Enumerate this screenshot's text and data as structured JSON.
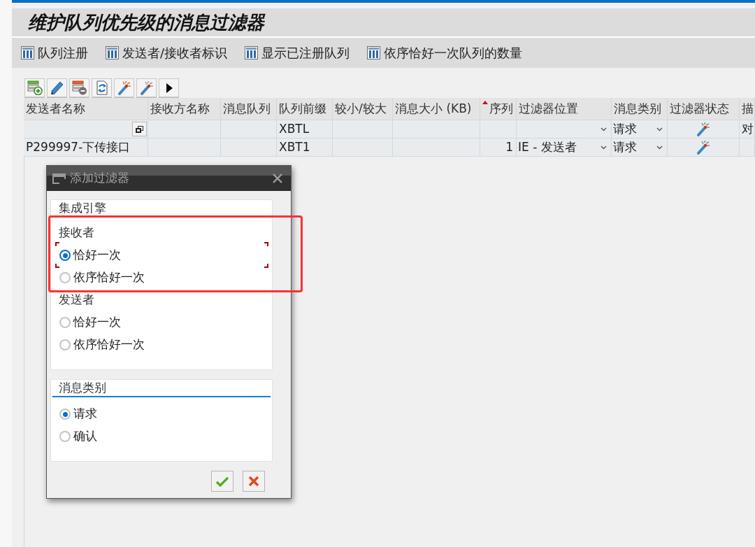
{
  "page": {
    "title": "维护队列优先级的消息过滤器"
  },
  "menu": [
    "队列注册",
    "发送者/接收者标识",
    "显示已注册队列",
    "依序恰好一次队列的数量"
  ],
  "table": {
    "columns": [
      {
        "label": "发送者名称",
        "sorted": false
      },
      {
        "label": "接收方名称",
        "sorted": false
      },
      {
        "label": "消息队列",
        "sorted": false
      },
      {
        "label": "队列前缀",
        "sorted": false
      },
      {
        "label": "较小/较大",
        "sorted": false
      },
      {
        "label": "消息大小 (KB)",
        "sorted": false
      },
      {
        "label": "序列",
        "sorted": true
      },
      {
        "label": "过滤器位置",
        "sorted": false
      },
      {
        "label": "消息类别",
        "sorted": false
      },
      {
        "label": "过滤器状态",
        "sorted": false
      },
      {
        "label": "描",
        "sorted": false
      }
    ],
    "rows": [
      {
        "cells": [
          {
            "kind": "help"
          },
          {
            "kind": "text"
          },
          {
            "kind": "text"
          },
          {
            "kind": "text",
            "text": "XBTL"
          },
          {
            "kind": "text"
          },
          {
            "kind": "text"
          },
          {
            "kind": "number"
          },
          {
            "kind": "dropdown"
          },
          {
            "kind": "dropdown",
            "text": "请求"
          },
          {
            "kind": "status"
          },
          {
            "kind": "text",
            "text": "对"
          }
        ]
      },
      {
        "cells": [
          {
            "kind": "text",
            "text": "P299997-下传接口"
          },
          {
            "kind": "text"
          },
          {
            "kind": "text"
          },
          {
            "kind": "text",
            "text": "XBT1"
          },
          {
            "kind": "text"
          },
          {
            "kind": "text"
          },
          {
            "kind": "number",
            "text": "1"
          },
          {
            "kind": "dropdown",
            "text": "IE - 发送者"
          },
          {
            "kind": "dropdown",
            "text": "请求"
          },
          {
            "kind": "status"
          },
          {
            "kind": "text"
          }
        ]
      }
    ]
  },
  "dialog": {
    "title": "添加过滤器",
    "groups": [
      {
        "title": "集成引擎",
        "underline": false,
        "sections": [
          {
            "label": "接收者",
            "options": [
              {
                "label": "恰好一次",
                "selected": true,
                "focused": true
              },
              {
                "label": "依序恰好一次",
                "selected": false,
                "focused": false
              }
            ]
          },
          {
            "label": "发送者",
            "options": [
              {
                "label": "恰好一次",
                "selected": false,
                "focused": false
              },
              {
                "label": "依序恰好一次",
                "selected": false,
                "focused": false
              }
            ]
          }
        ]
      },
      {
        "title": "消息类别",
        "underline": true,
        "sections": [
          {
            "options": [
              {
                "label": "请求",
                "selected": true,
                "focused": false
              },
              {
                "label": "确认",
                "selected": false,
                "focused": false
              }
            ]
          }
        ]
      }
    ]
  }
}
